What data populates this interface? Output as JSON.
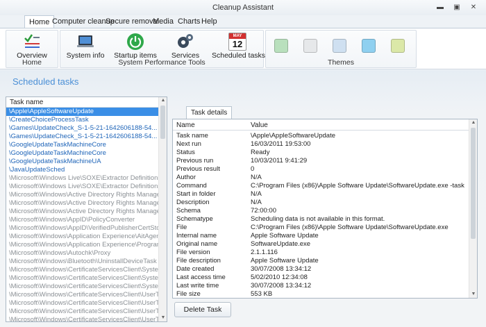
{
  "window": {
    "title": "Cleanup Assistant"
  },
  "menu": [
    "Home",
    "Computer cleanup",
    "Secure removal",
    "Media",
    "Charts",
    "Help"
  ],
  "ribbon": {
    "home_group": {
      "label": "Home",
      "overview": "Overview"
    },
    "tools_group": {
      "label": "System Performance Tools",
      "system_info": "System info",
      "startup_items": "Startup items",
      "services": "Services",
      "scheduled_tasks": "Scheduled tasks",
      "calendar_month": "MAY",
      "calendar_day": "12"
    },
    "themes_group": {
      "label": "Themes",
      "swatches": [
        "#b9e0bd",
        "#e6e8ea",
        "#cfe0f1",
        "#8fd0f0",
        "#dbe8a8"
      ]
    }
  },
  "page_title": "Scheduled tasks",
  "task_list": {
    "header": "Task name",
    "rows": [
      "\\Apple\\AppleSoftwareUpdate",
      "\\CreateChoiceProcessTask",
      "\\Games\\UpdateCheck_S-1-5-21-1642606188-54...",
      "\\Games\\UpdateCheck_S-1-5-21-1642606188-54...",
      "\\GoogleUpdateTaskMachineCore",
      "\\GoogleUpdateTaskMachineCore",
      "\\GoogleUpdateTaskMachineUA",
      "\\JavaUpdateSched",
      "\\Microsoft\\Windows Live\\SOXE\\Extractor Definitions Upda...",
      "\\Microsoft\\Windows Live\\SOXE\\Extractor Definitions Upda...",
      "\\Microsoft\\Windows\\Active Directory Rights Management ...",
      "\\Microsoft\\Windows\\Active Directory Rights Management ...",
      "\\Microsoft\\Windows\\Active Directory Rights Management ...",
      "\\Microsoft\\Windows\\AppID\\PolicyConverter",
      "\\Microsoft\\Windows\\AppID\\VerifiedPublisherCertStoreCheck",
      "\\Microsoft\\Windows\\Application Experience\\AitAgent",
      "\\Microsoft\\Windows\\Application Experience\\ProgramData...",
      "\\Microsoft\\Windows\\Autochk\\Proxy",
      "\\Microsoft\\Windows\\Bluetooth\\UninstallDeviceTask",
      "\\Microsoft\\Windows\\CertificateServicesClient\\SystemTask",
      "\\Microsoft\\Windows\\CertificateServicesClient\\SystemTask",
      "\\Microsoft\\Windows\\CertificateServicesClient\\SystemTask",
      "\\Microsoft\\Windows\\CertificateServicesClient\\UserTask",
      "\\Microsoft\\Windows\\CertificateServicesClient\\UserTask",
      "\\Microsoft\\Windows\\CertificateServicesClient\\UserTask",
      "\\Microsoft\\Windows\\CertificateServicesClient\\UserTask"
    ]
  },
  "details": {
    "tab_label": "Task details",
    "col_name": "Name",
    "col_value": "Value",
    "rows": [
      {
        "name": "Task name",
        "value": "\\Apple\\AppleSoftwareUpdate"
      },
      {
        "name": "Next run",
        "value": "16/03/2011 19:53:00"
      },
      {
        "name": "Status",
        "value": "Ready"
      },
      {
        "name": "Previous run",
        "value": "10/03/2011 9:41:29"
      },
      {
        "name": "Previous result",
        "value": "0"
      },
      {
        "name": "Author",
        "value": "N/A"
      },
      {
        "name": "Command",
        "value": "C:\\Program Files (x86)\\Apple Software Update\\SoftwareUpdate.exe -task"
      },
      {
        "name": "Start in folder",
        "value": "N/A"
      },
      {
        "name": "Description",
        "value": "N/A"
      },
      {
        "name": "Schema",
        "value": "72:00:00"
      },
      {
        "name": "Schematype",
        "value": "Scheduling data is not available in this format."
      },
      {
        "name": "File",
        "value": "C:\\Program Files (x86)\\Apple Software Update\\SoftwareUpdate.exe"
      },
      {
        "name": "Internal name",
        "value": "Apple Software Update"
      },
      {
        "name": "Original name",
        "value": "SoftwareUpdate.exe"
      },
      {
        "name": "File version",
        "value": "2.1.1.116"
      },
      {
        "name": "File description",
        "value": "Apple Software Update"
      },
      {
        "name": "Date created",
        "value": "30/07/2008 13:34:12"
      },
      {
        "name": "Last access time",
        "value": "5/02/2010 12:34:08"
      },
      {
        "name": "Last write time",
        "value": "30/07/2008 13:34:12"
      },
      {
        "name": "File size",
        "value": "553 KB"
      }
    ]
  },
  "delete_button": "Delete Task"
}
